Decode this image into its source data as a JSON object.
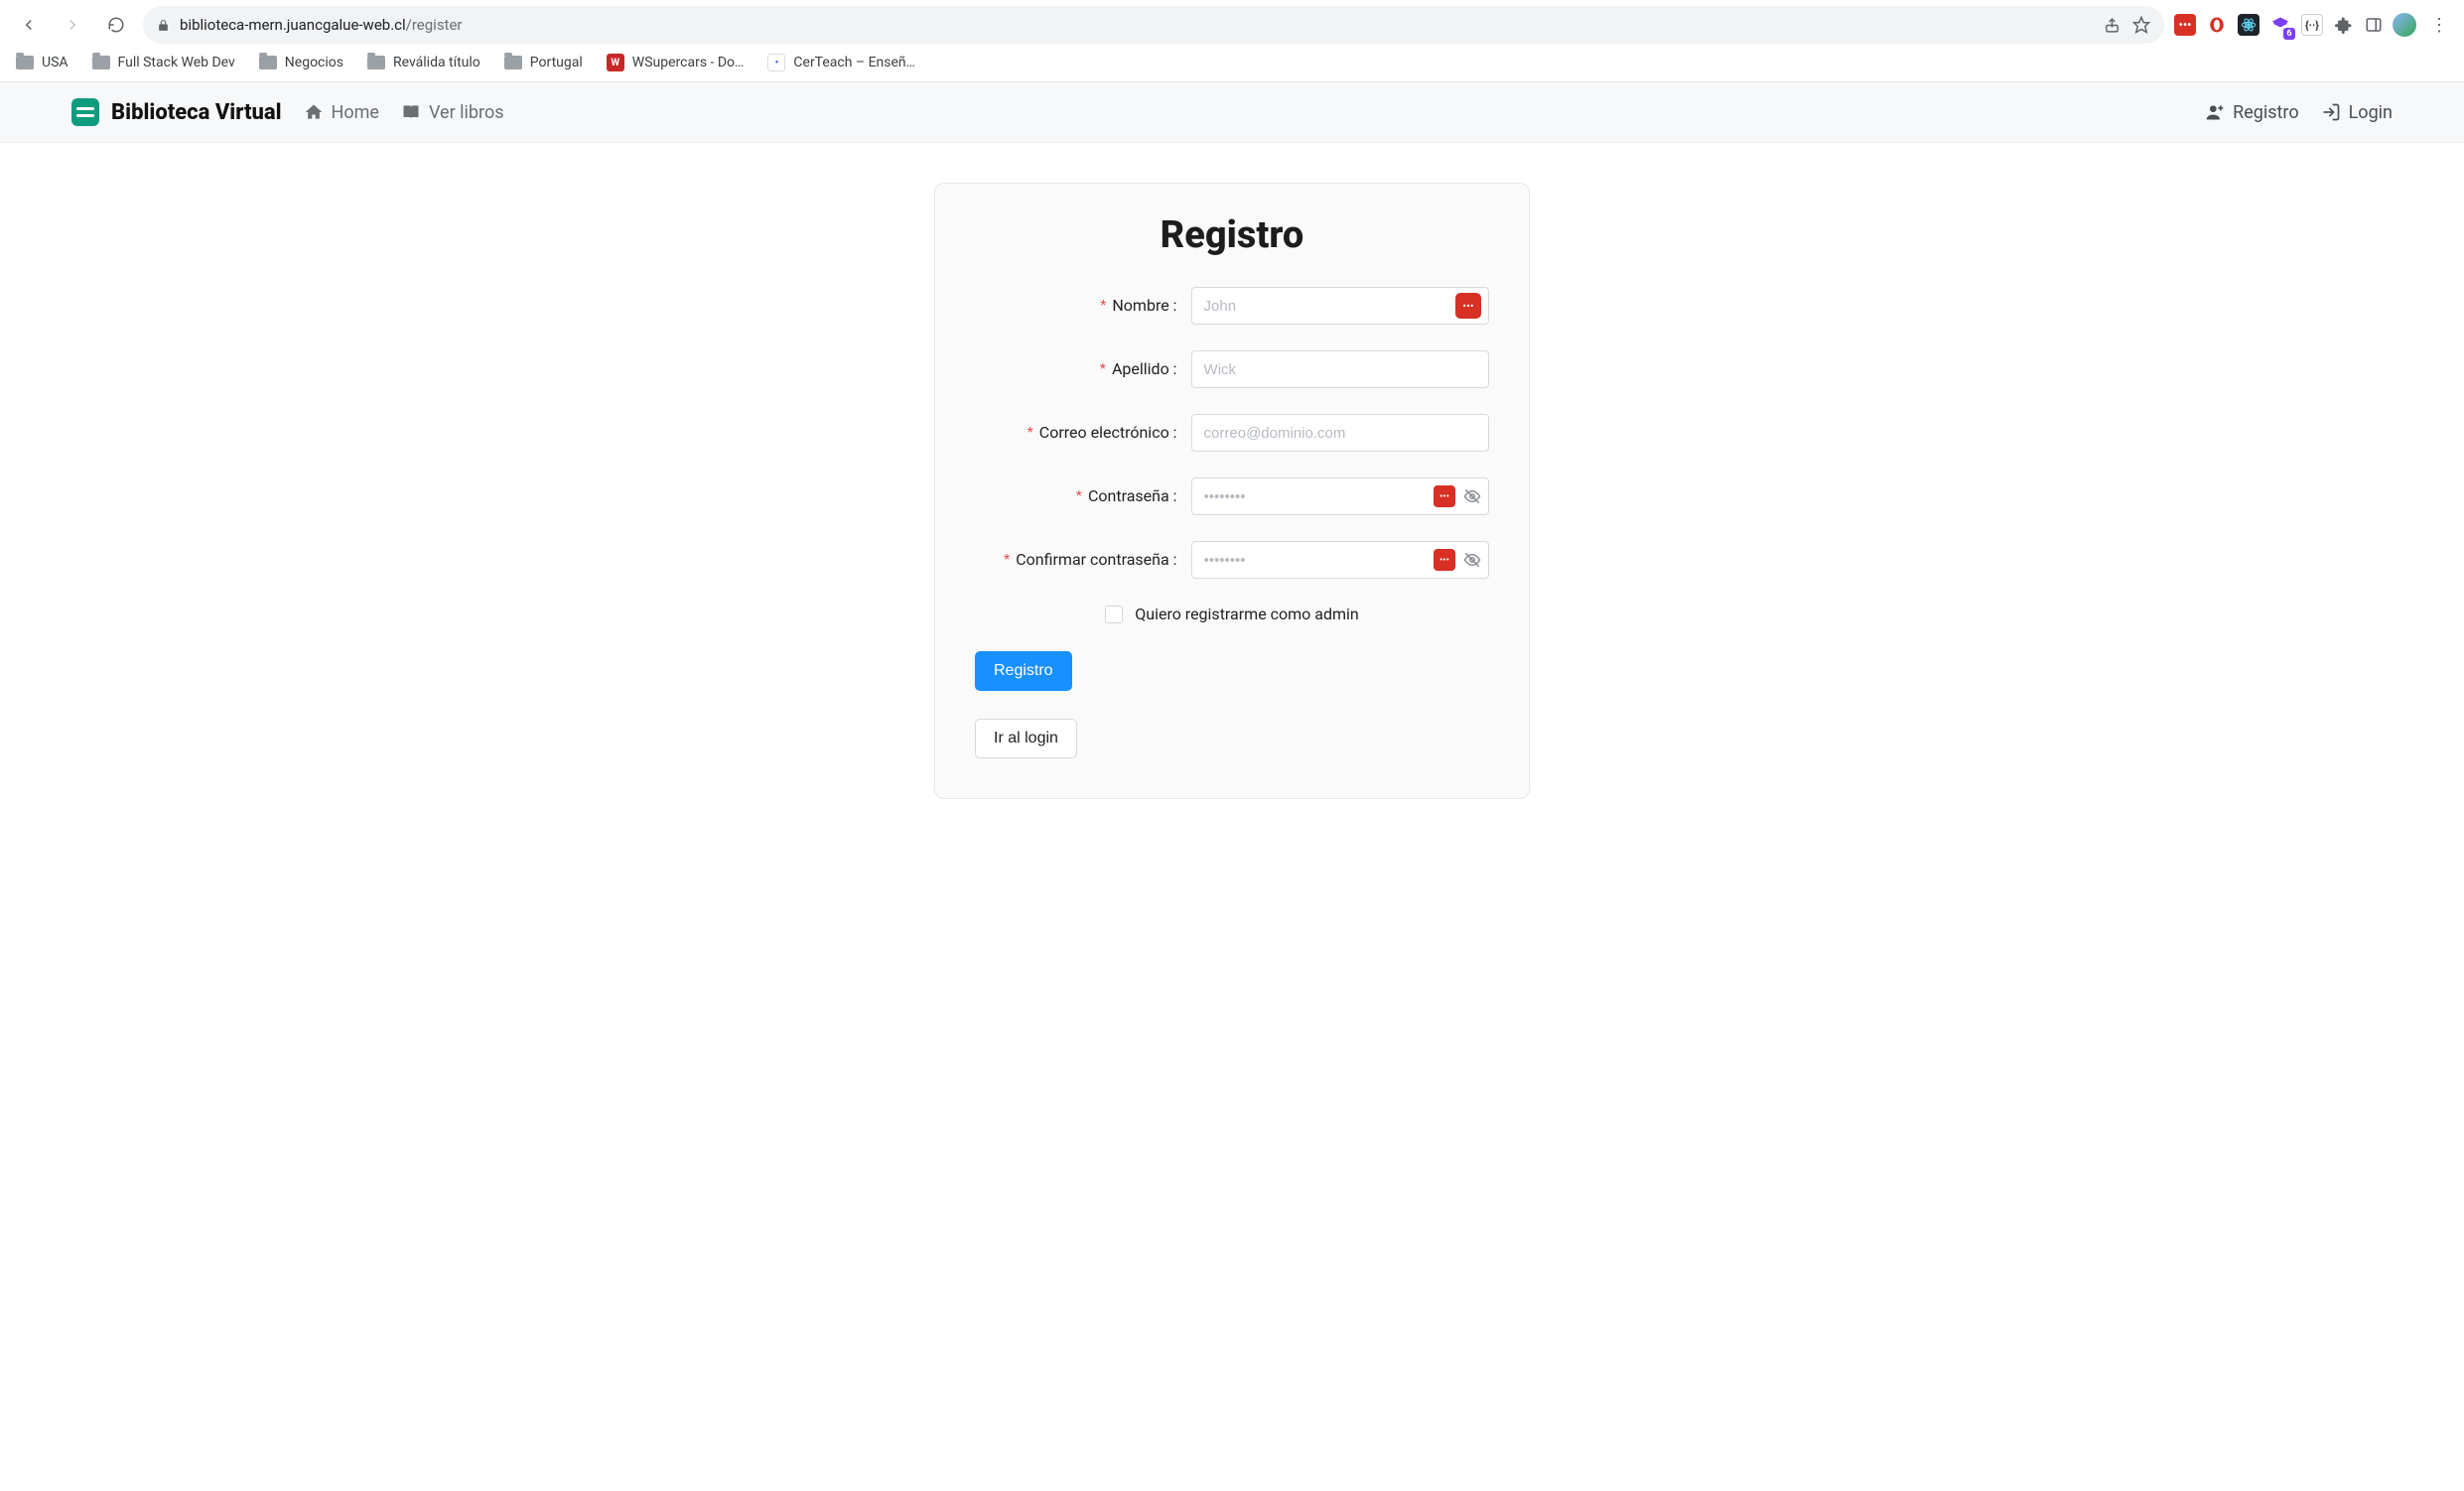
{
  "browser": {
    "url_host": "biblioteca-mern.juancgalue-web.cl",
    "url_path": "/register",
    "bookmarks": [
      {
        "label": "USA",
        "type": "folder"
      },
      {
        "label": "Full Stack Web Dev",
        "type": "folder"
      },
      {
        "label": "Negocios",
        "type": "folder"
      },
      {
        "label": "Reválida título",
        "type": "folder"
      },
      {
        "label": "Portugal",
        "type": "folder"
      },
      {
        "label": "WSupercars - Do…",
        "type": "fav-red",
        "initial": "W"
      },
      {
        "label": "CerTeach – Enseñ…",
        "type": "fav-white",
        "initial": "•"
      }
    ],
    "ext_badge": "6"
  },
  "navbar": {
    "brand": "Biblioteca Virtual",
    "links": {
      "home": "Home",
      "books": "Ver libros"
    },
    "right": {
      "register": "Registro",
      "login": "Login"
    }
  },
  "form": {
    "title": "Registro",
    "fields": {
      "name": {
        "label": "Nombre",
        "placeholder": "John",
        "value": ""
      },
      "last": {
        "label": "Apellido",
        "placeholder": "Wick",
        "value": ""
      },
      "email": {
        "label": "Correo electrónico",
        "placeholder": "correo@dominio.com",
        "value": ""
      },
      "pass": {
        "label": "Contraseña",
        "placeholder": "••••••••",
        "value": ""
      },
      "confirm": {
        "label": "Confirmar contraseña",
        "placeholder": "••••••••",
        "value": ""
      }
    },
    "admin_checkbox": "Quiero registrarme como admin",
    "submit": "Registro",
    "to_login": "Ir al login",
    "colon": ":"
  }
}
